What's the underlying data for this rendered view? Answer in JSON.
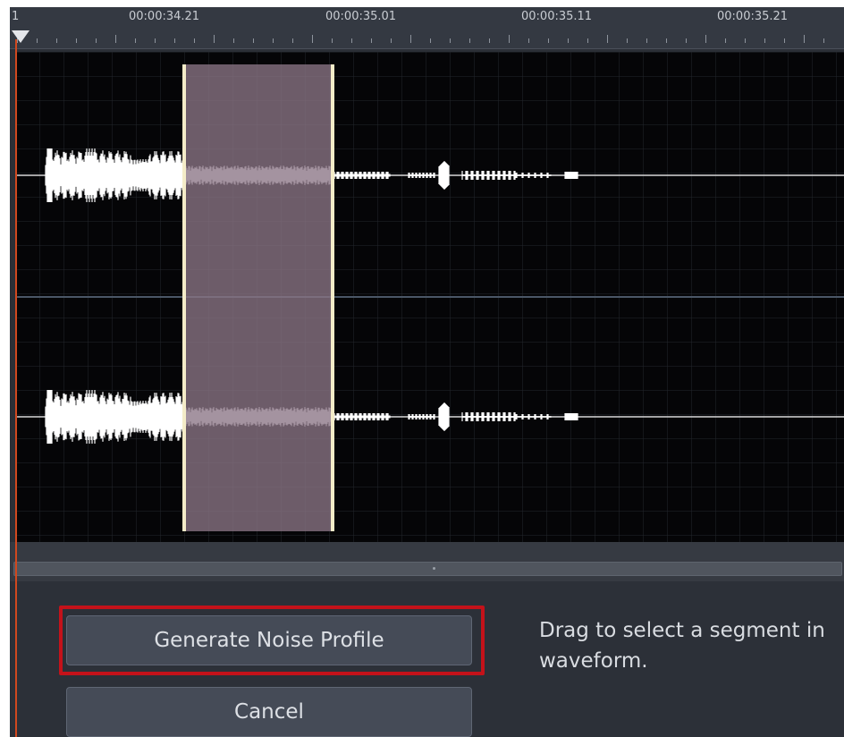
{
  "ruler": {
    "start_marker": "1",
    "timecodes": [
      "00:00:34.21",
      "00:00:35.01",
      "00:00:35.11",
      "00:00:35.21"
    ]
  },
  "waveform": {
    "channels": 2,
    "selection_color": "#8a7585",
    "selection_edge_color": "#f4ecc8",
    "waveform_color": "#ffffff"
  },
  "actions": {
    "generate_label": "Generate Noise Profile",
    "cancel_label": "Cancel"
  },
  "hint": {
    "line1": "Drag to select a segment in",
    "line2": "waveform."
  },
  "colors": {
    "playhead": "#d0481f",
    "highlight_box": "#c4121a"
  }
}
